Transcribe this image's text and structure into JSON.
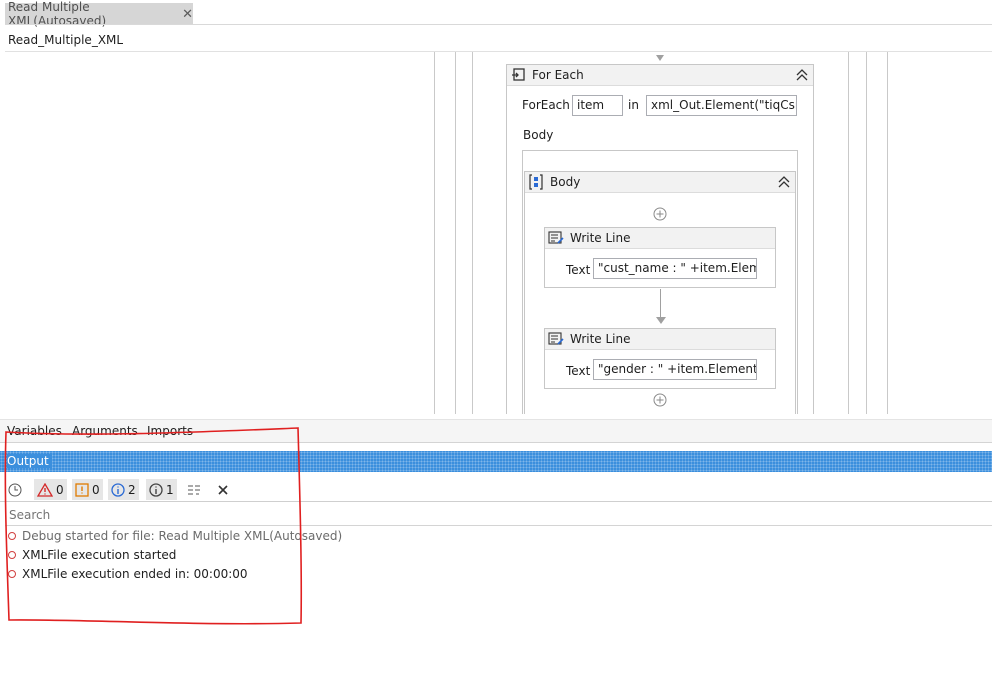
{
  "document_tab": {
    "title": "Read Multiple XML(Autosaved)",
    "close_glyph": "✕"
  },
  "breadcrumb": "Read_Multiple_XML",
  "foreach": {
    "title": "For Each",
    "foreach_label": "ForEach",
    "item_value": "item",
    "in_label": "in",
    "collection_value": "xml_Out.Element(\"tiqCsr\")",
    "body_label": "Body"
  },
  "body_sequence": {
    "title": "Body"
  },
  "write_lines": [
    {
      "title": "Write Line",
      "text_label": "Text",
      "text_value": "\"cust_name : \" +item.Elemen"
    },
    {
      "title": "Write Line",
      "text_label": "Text",
      "text_value": "\"gender : \" +item.Elements(\""
    }
  ],
  "panel_tabs": [
    "Variables",
    "Arguments",
    "Imports"
  ],
  "output": {
    "title": "Output",
    "error_count": "0",
    "warning_count": "0",
    "info_count": "2",
    "trace_count": "1",
    "search_placeholder": "Search"
  },
  "log": [
    "Debug started for file: Read Multiple XML(Autosaved)",
    "XMLFile execution started",
    "XMLFile execution ended in: 00:00:00"
  ],
  "colors": {
    "output_bar": "#3b8fdd",
    "annotation": "#e02020",
    "error": "#d42a2a",
    "warning": "#e07b00",
    "info": "#2a6ad4"
  },
  "icons": [
    "foreach-icon",
    "sequence-icon",
    "writeline-icon",
    "collapse-icon",
    "add-activity-icon",
    "clock-icon",
    "error-icon",
    "warning-icon",
    "info-icon",
    "trace-icon",
    "timestamp-toggle-icon",
    "clear-icon"
  ]
}
